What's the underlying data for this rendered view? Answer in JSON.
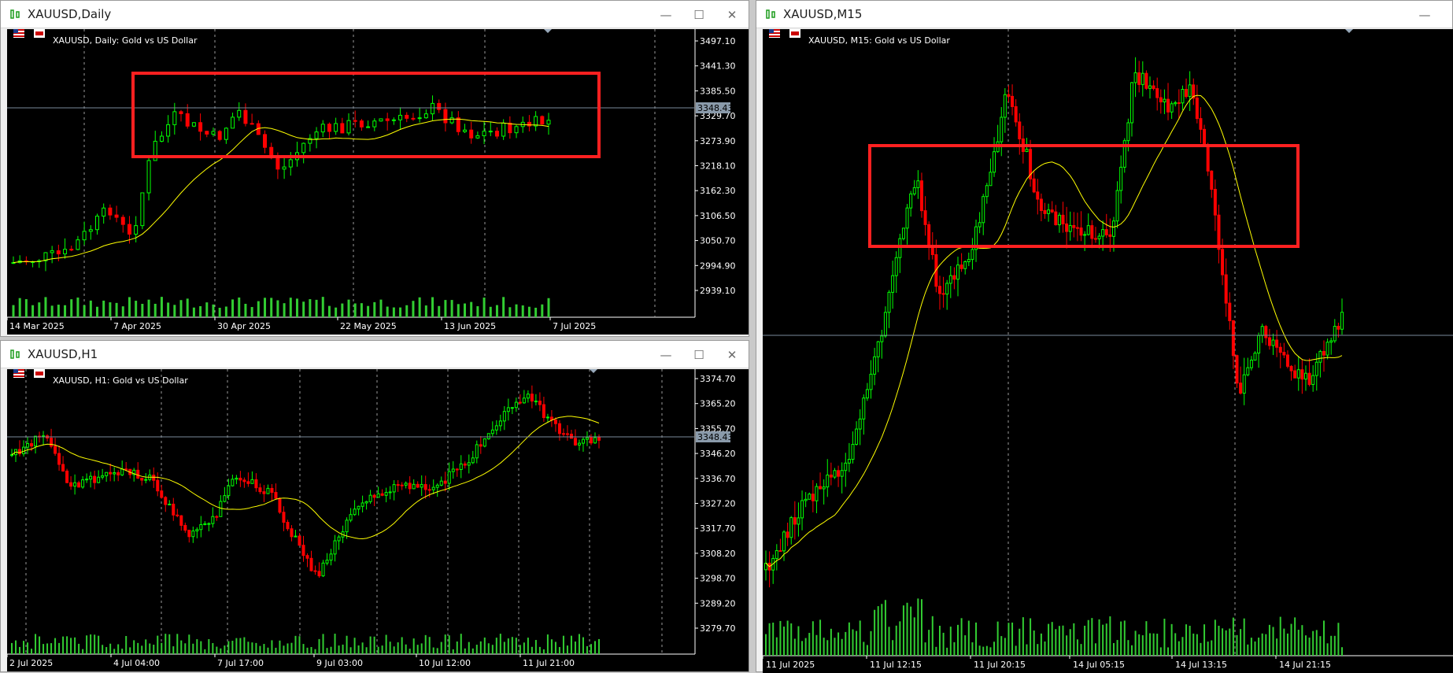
{
  "windows": [
    {
      "id": "daily",
      "title": "XAUUSD,Daily",
      "chart_label": "XAUUSD, Daily:  Gold vs US Dollar",
      "price_labels": [
        "3497.10",
        "3441.30",
        "3385.50",
        "3329.70",
        "3273.90",
        "3218.10",
        "3162.30",
        "3106.50",
        "3050.70",
        "2994.90",
        "2939.10"
      ],
      "current_price": "3348.43",
      "time_labels": [
        "14 Mar 2025",
        "7 Apr 2025",
        "30 Apr 2025",
        "22 May 2025",
        "13 Jun 2025",
        "7 Jul 2025"
      ]
    },
    {
      "id": "h1",
      "title": "XAUUSD,H1",
      "chart_label": "XAUUSD, H1:  Gold vs US Dollar",
      "price_labels": [
        "3374.70",
        "3365.20",
        "3355.70",
        "3346.20",
        "3336.70",
        "3327.20",
        "3317.70",
        "3308.20",
        "3298.70",
        "3289.20",
        "3279.70"
      ],
      "current_price": "3348.43",
      "time_labels": [
        "2 Jul 2025",
        "4 Jul 04:00",
        "7 Jul 17:00",
        "9 Jul 03:00",
        "10 Jul 12:00",
        "11 Jul 21:00"
      ]
    },
    {
      "id": "m15",
      "title": "XAUUSD,M15",
      "chart_label": "XAUUSD, M15:  Gold vs US Dollar",
      "price_labels": [],
      "current_price": "",
      "time_labels": [
        "11 Jul 2025",
        "11 Jul 12:15",
        "11 Jul 20:15",
        "14 Jul 05:15",
        "14 Jul 13:15",
        "14 Jul 21:15"
      ]
    }
  ],
  "window_buttons": {
    "minimize": "—",
    "maximize": "☐",
    "close": "✕"
  },
  "colors": {
    "bull": "#00ff00",
    "bear": "#ff0000",
    "ma": "#ffff00",
    "volume": "#32cd32",
    "highlight": "#ff2020",
    "grid": "#9a9a9a"
  }
}
